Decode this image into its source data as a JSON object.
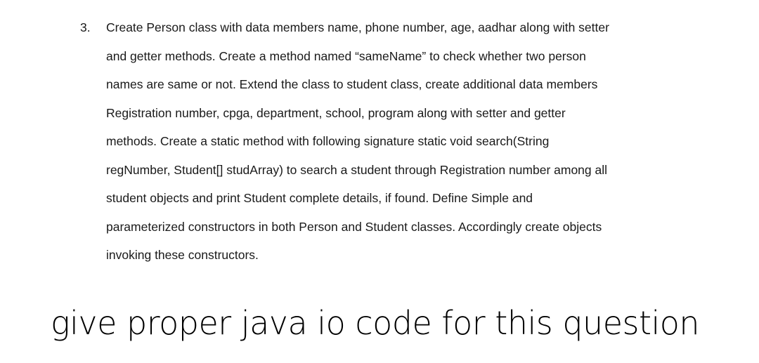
{
  "question": {
    "number": "3.",
    "lines": [
      "Create Person class with data members name, phone number, age, aadhar along with setter",
      "and getter methods. Create a method named “sameName” to check whether two person",
      "names are same or not. Extend the class to student class, create additional data members",
      "Registration number, cpga, department, school, program along with setter and getter",
      "methods. Create a static method with following signature static void search(String",
      "regNumber, Student[] studArray) to search a student through Registration number among all",
      "student objects and print Student complete details, if found. Define Simple and",
      "parameterized constructors in both Person and Student classes. Accordingly create objects",
      "invoking these constructors."
    ]
  },
  "prompt": {
    "text": "give proper java io code for this question"
  }
}
